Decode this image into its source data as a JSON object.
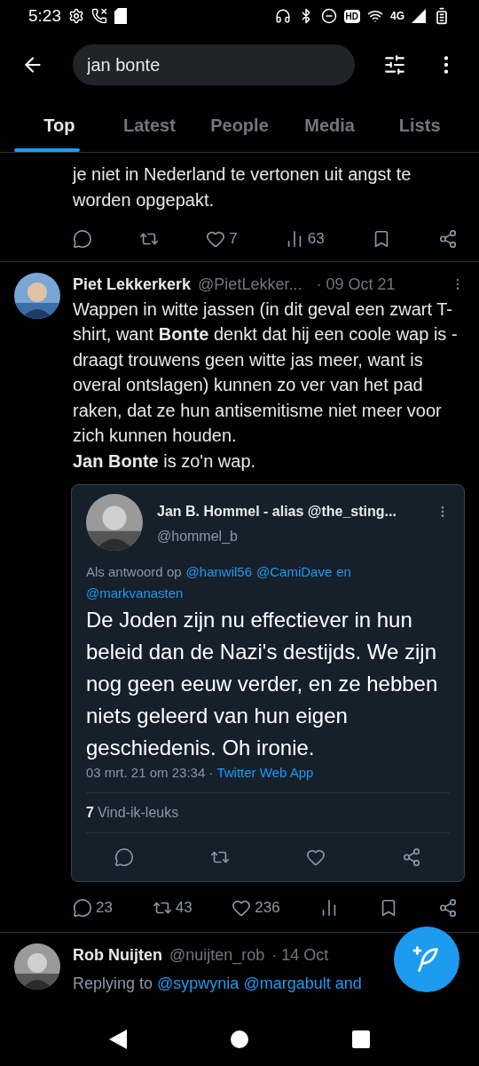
{
  "status_bar": {
    "time": "5:23",
    "hd": "HD",
    "network": "4G"
  },
  "search": {
    "value": "jan bonte"
  },
  "tabs": [
    {
      "label": "Top",
      "selected": true
    },
    {
      "label": "Latest",
      "selected": false
    },
    {
      "label": "People",
      "selected": false
    },
    {
      "label": "Media",
      "selected": false
    },
    {
      "label": "Lists",
      "selected": false
    }
  ],
  "tweets": [
    {
      "kind": "tail",
      "body": [
        "je niet in Nederland te vertonen uit angst te worden opgepakt."
      ],
      "actions": [
        {
          "kind": "reply"
        },
        {
          "kind": "retweet"
        },
        {
          "kind": "like",
          "count": "7"
        },
        {
          "kind": "views",
          "count": "63"
        },
        {
          "kind": "bookmark"
        },
        {
          "kind": "share"
        }
      ]
    },
    {
      "kind": "full",
      "name": "Piet Lekkerkerk",
      "handle": "@PietLekker...",
      "date": "· 09 Oct 21",
      "body": [
        "Wappen in witte jassen (in dit geval een zwart T-shirt, want **Bonte** denkt dat hij een coole wap is - draagt trouwens geen witte jas meer, want is overal ontslagen) kunnen zo ver van het pad raken, dat ze hun antisemitisme niet meer voor zich kunnen houden.",
        "**Jan Bonte** is zo'n wap."
      ],
      "quote": {
        "name": "Jan B. Hommel - alias @the_sting...",
        "handle": "@hommel_b",
        "reply_to": [
          {
            "text": "Als antwoord op",
            "link": false
          },
          {
            "text": "@hanwil56",
            "link": true
          },
          {
            "text": "@CamiDave",
            "link": true
          },
          {
            "text": "en",
            "link": true
          },
          {
            "text": "@markvanasten",
            "link": true
          }
        ],
        "body": "De Joden zijn nu effectiever in hun beleid dan de Nazi's destijds. We zijn nog geen eeuw verder, en ze hebben niets geleerd van hun eigen geschiedenis. Oh ironie.",
        "date": "03 mrt. 21 om 23:34 ·",
        "source": "Twitter Web App",
        "likes_count": "7",
        "likes_label": "Vind-ik-leuks",
        "actions": [
          {
            "kind": "reply"
          },
          {
            "kind": "retweet"
          },
          {
            "kind": "like"
          },
          {
            "kind": "share"
          }
        ]
      },
      "actions": [
        {
          "kind": "reply",
          "count": "23"
        },
        {
          "kind": "retweet",
          "count": "43"
        },
        {
          "kind": "like",
          "count": "236"
        },
        {
          "kind": "views"
        },
        {
          "kind": "bookmark"
        },
        {
          "kind": "share"
        }
      ]
    },
    {
      "kind": "partial",
      "name": "Rob Nuijten",
      "handle": "@nuijten_rob",
      "date": "· 14 Oct",
      "reply_to": [
        {
          "text": "Replying to",
          "link": false
        },
        {
          "text": "@sypwynia",
          "link": true
        },
        {
          "text": "@margabult",
          "link": true
        },
        {
          "text": "and",
          "link": true
        }
      ]
    }
  ]
}
